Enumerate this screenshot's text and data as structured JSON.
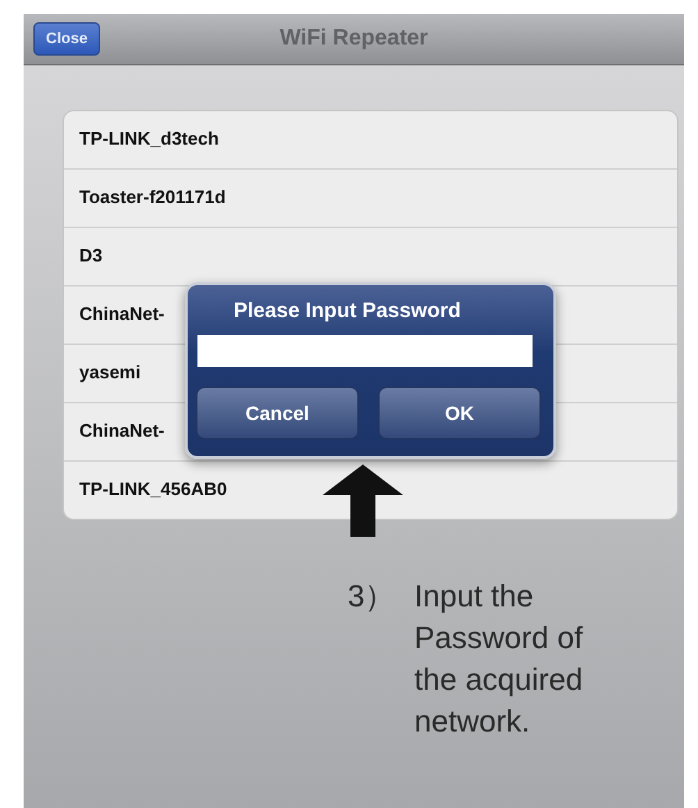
{
  "nav": {
    "close": "Close",
    "title": "WiFi Repeater"
  },
  "networks": [
    {
      "name": "TP-LINK_d3tech"
    },
    {
      "name": "Toaster-f201171d"
    },
    {
      "name": "D3"
    },
    {
      "name": "ChinaNet-"
    },
    {
      "name": "yasemi"
    },
    {
      "name": "ChinaNet-"
    },
    {
      "name": "TP-LINK_456AB0"
    }
  ],
  "dialog": {
    "title": "Please Input Password",
    "buttons": [
      "Cancel",
      "OK"
    ]
  },
  "annotation": {
    "number": "3）",
    "lines": [
      "Input the",
      "Password of",
      "the acquired",
      "network."
    ]
  }
}
